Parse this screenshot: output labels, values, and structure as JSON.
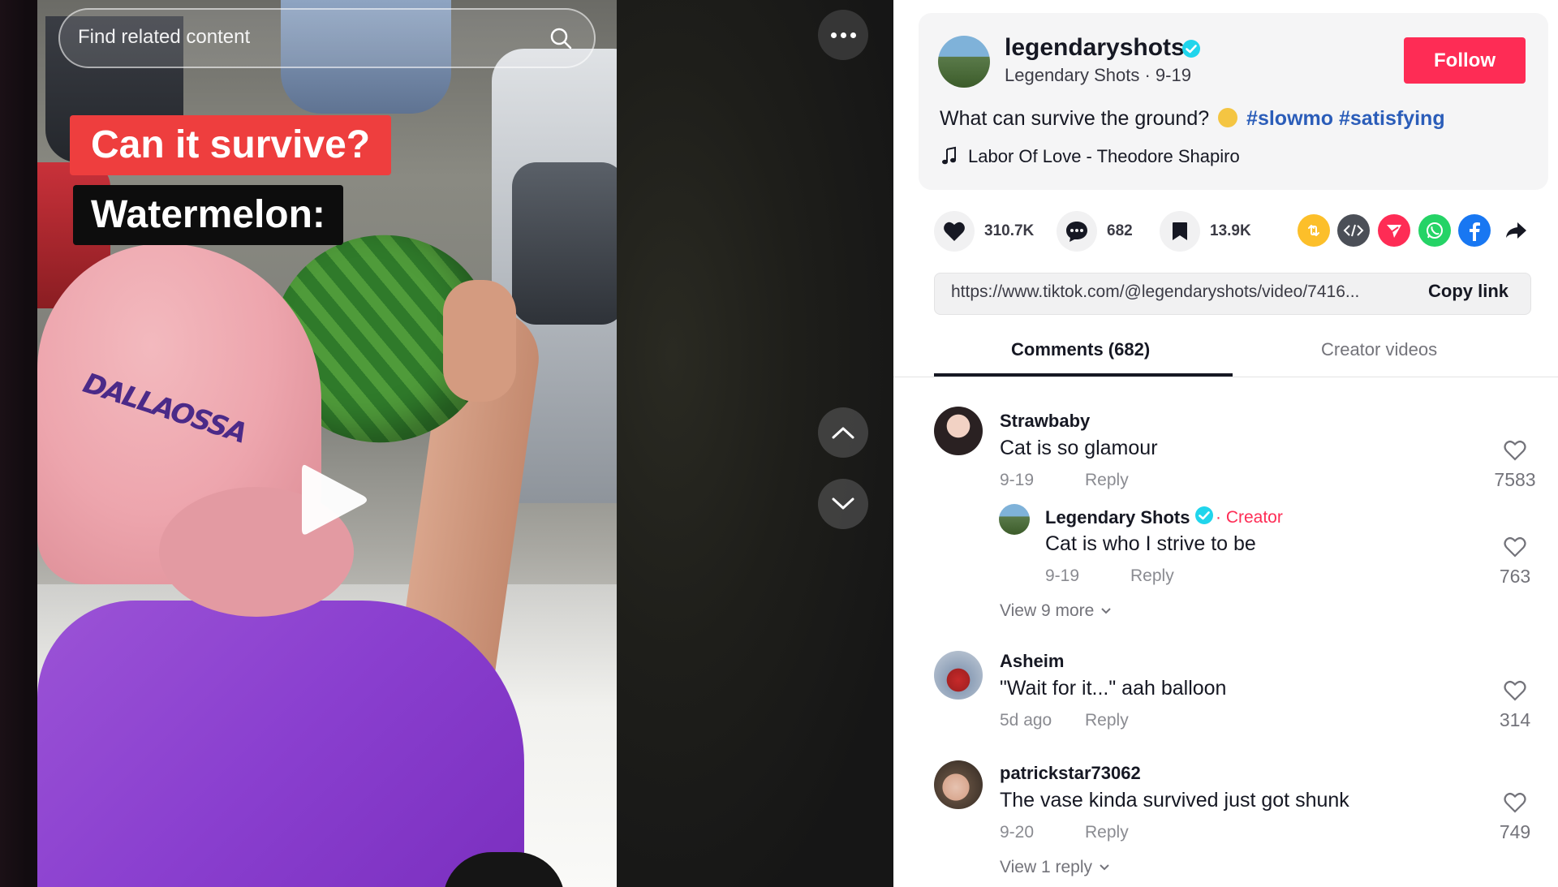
{
  "video": {
    "search_placeholder": "Find related content",
    "caption_line1": "Can it survive?",
    "caption_line2": "Watermelon:",
    "hat_text": "DALLAOSSA"
  },
  "creator": {
    "handle": "legendaryshots",
    "display_name": "Legendary Shots",
    "date": "9-19",
    "sub_line": "Legendary Shots · 9-19",
    "follow_label": "Follow"
  },
  "post": {
    "description_text": "What can survive the ground?",
    "hashtags": [
      "#slowmo",
      "#satisfying"
    ],
    "music": "Labor Of Love - Theodore Shapiro"
  },
  "stats": {
    "likes": "310.7K",
    "comments": "682",
    "saves": "13.9K"
  },
  "share_icons": [
    "repost-icon",
    "embed-icon",
    "send-icon",
    "whatsapp-icon",
    "facebook-icon",
    "share-arrow-icon"
  ],
  "link": {
    "url": "https://www.tiktok.com/@legendaryshots/video/7416...",
    "copy_label": "Copy link"
  },
  "tabs": {
    "comments": "Comments (682)",
    "creator_videos": "Creator videos"
  },
  "comments": [
    {
      "user": "Strawbaby",
      "text": "Cat is so glamour",
      "date": "9-19",
      "reply": "Reply",
      "likes": "7583",
      "replies": [
        {
          "user": "Legendary Shots",
          "badge": "Creator",
          "text": "Cat is who I strive to be",
          "date": "9-19",
          "reply": "Reply",
          "likes": "763"
        }
      ],
      "view_more": "View 9 more"
    },
    {
      "user": "Asheim",
      "text": "\"Wait for it...\" aah balloon",
      "date": "5d ago",
      "reply": "Reply",
      "likes": "314"
    },
    {
      "user": "patrickstar73062",
      "text": "The vase kinda survived just got shunk",
      "date": "9-20",
      "reply": "Reply",
      "likes": "749",
      "view_more": "View 1 reply"
    }
  ],
  "colors": {
    "follow": "#fe2c55",
    "hashtag": "#2b5db9",
    "creator_badge": "#fe2c55",
    "verified": "#20d5ec"
  }
}
